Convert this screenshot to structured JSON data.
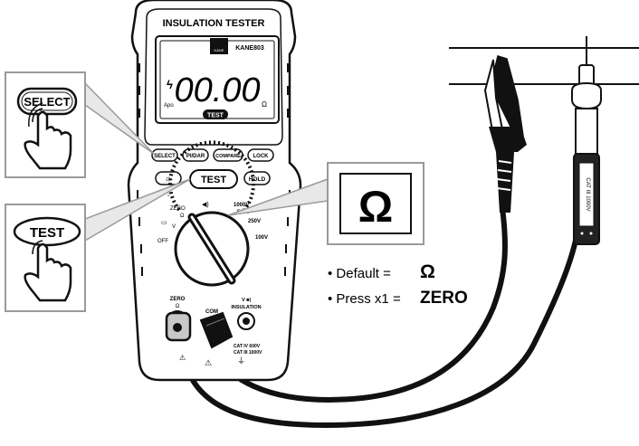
{
  "meter": {
    "title": "INSULATION TESTER",
    "brand": "KANE",
    "model": "KANE803",
    "display": {
      "reading": "00.00",
      "apo": "Apo",
      "unit": "Ω",
      "test_badge": "TEST"
    },
    "buttons": [
      "SELECT",
      "PI/DAR",
      "COMPARE",
      "LOCK",
      "TEST",
      "HOLD"
    ],
    "backlight_icon": "sun-icon",
    "dial": {
      "labels": [
        "ZERO",
        "Ω",
        "OFF",
        "V",
        "1000V",
        "500V",
        "250V",
        "100V"
      ]
    },
    "terminals": {
      "zero_label": "ZERO",
      "zero_sub": "Ω",
      "com_label": "COM",
      "insulation_label": "INSULATION",
      "insulation_sub": "V ■|",
      "cat_line1": "CAT IV 600V",
      "cat_line2": "CAT III 1000V"
    }
  },
  "callouts": {
    "select_label": "SELECT",
    "test_label": "TEST",
    "ohm_symbol": "Ω"
  },
  "notes": {
    "line1_prefix": "• Default  =",
    "line1_value": "Ω",
    "line2_prefix": "• Press x1 =",
    "line2_value": "ZERO"
  },
  "probe": {
    "label": "CAT III 1000V"
  },
  "colors": {
    "ink": "#111111",
    "outline_gray": "#9a9a9a",
    "meter_body": "#ffffff",
    "lcd": "#ffffff",
    "connector": "#c8c8c8"
  }
}
